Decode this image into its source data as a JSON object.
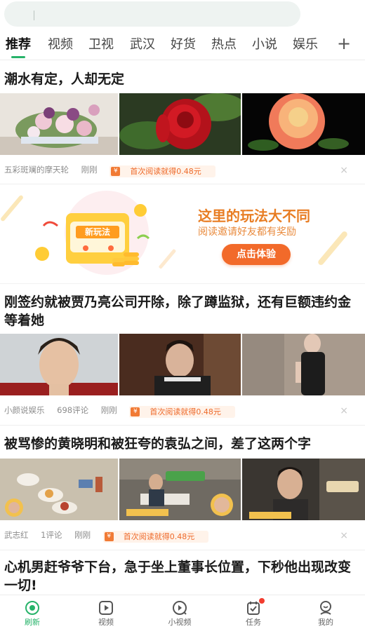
{
  "search": {
    "placeholder": ""
  },
  "tabs": [
    {
      "label": "推荐",
      "active": true
    },
    {
      "label": "视频"
    },
    {
      "label": "卫视"
    },
    {
      "label": "武汉"
    },
    {
      "label": "好货"
    },
    {
      "label": "热点"
    },
    {
      "label": "小说"
    },
    {
      "label": "娱乐"
    }
  ],
  "tab_add_label": "+",
  "articles": [
    {
      "title": "潮水有定，人却无定",
      "source": "五彩斑斓的摩天轮",
      "comments": "",
      "time": "刚刚",
      "reward": "首次阅读就得0.48元"
    },
    {
      "title": "刚签约就被贾乃亮公司开除，除了蹲监狱，还有巨额违约金等着她",
      "source": "小颜说娱乐",
      "comments": "698评论",
      "time": "刚刚",
      "reward": "首次阅读就得0.48元"
    },
    {
      "title": "被骂惨的黄晓明和被狂夸的袁弘之间，差了这两个字",
      "source": "武志红",
      "comments": "1评论",
      "time": "刚刚",
      "reward": "首次阅读就得0.48元"
    },
    {
      "title": "心机男赶爷爷下台，急于坐上董事长位置，下秒他出现改变一切!"
    }
  ],
  "banner": {
    "title": "这里的玩法大不同",
    "subtitle": "阅读邀请好友都有奖励",
    "button": "点击体验",
    "machine_label": "新玩法"
  },
  "reward_icon": "¥",
  "close_icon": "×",
  "bottom_nav": [
    {
      "label": "刷新",
      "icon": "refresh-icon",
      "active": true
    },
    {
      "label": "视频",
      "icon": "video-play-icon"
    },
    {
      "label": "小视频",
      "icon": "small-video-icon"
    },
    {
      "label": "任务",
      "icon": "task-icon",
      "badge": true
    },
    {
      "label": "我的",
      "icon": "profile-icon"
    }
  ],
  "colors": {
    "accent": "#27b36a",
    "reward_text": "#ee6a2a",
    "banner_button": "#f26a2a",
    "badge": "#f23c2f"
  }
}
